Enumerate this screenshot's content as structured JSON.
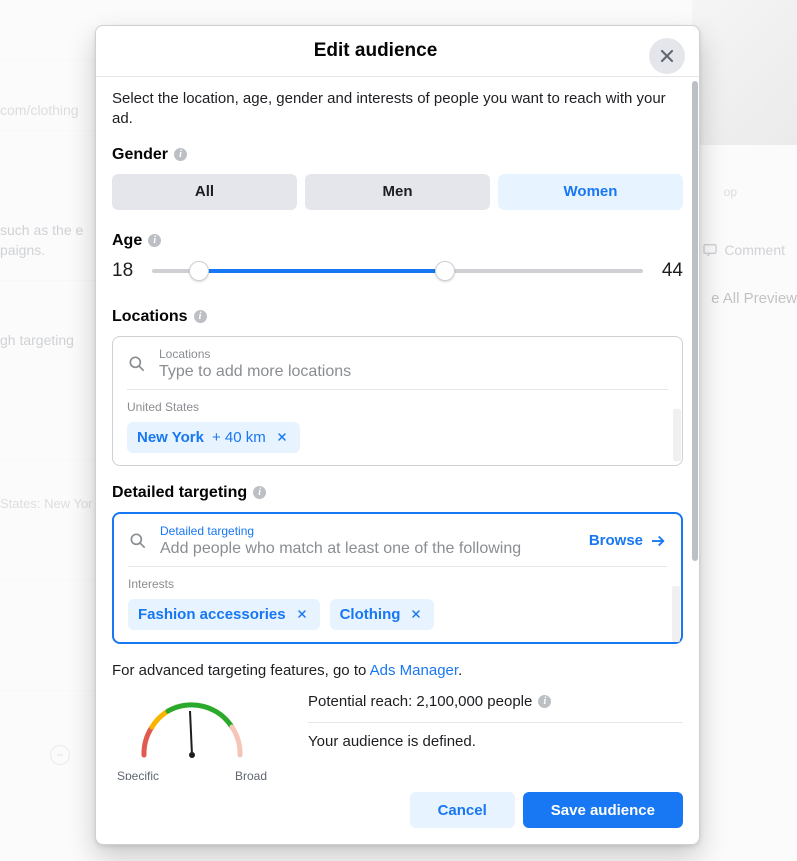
{
  "backdrop": {
    "url_fragment": "com/clothing",
    "line1": "such as the e",
    "line2": "paigns.",
    "targeting_label": "gh targeting",
    "states_line": "States: New Yor",
    "preview_link": "e All Preview",
    "shop": "op",
    "comment": "Comment"
  },
  "modal": {
    "title": "Edit audience",
    "intro": "Select the location, age, gender and interests of people you want to reach with your ad.",
    "gender": {
      "label": "Gender",
      "options": [
        "All",
        "Men",
        "Women"
      ],
      "selected": "Women"
    },
    "age": {
      "label": "Age",
      "min": 18,
      "max": 44,
      "range_min": 13,
      "range_max": 65
    },
    "locations": {
      "label": "Locations",
      "search_label": "Locations",
      "placeholder": "Type to add more locations",
      "group_label": "United States",
      "chips": [
        {
          "name": "New York",
          "radius": "+ 40 km"
        }
      ]
    },
    "targeting": {
      "label": "Detailed targeting",
      "search_label": "Detailed targeting",
      "placeholder": "Add people who match at least one of the following",
      "browse": "Browse",
      "group_label": "Interests",
      "chips": [
        "Fashion accessories",
        "Clothing"
      ]
    },
    "advanced_prefix": "For advanced targeting features, go to ",
    "advanced_link": "Ads Manager",
    "gauge": {
      "specific": "Specific",
      "broad": "Broad"
    },
    "reach_prefix": "Potential reach: ",
    "reach_value": "2,100,000 people",
    "defined": "Your audience is defined.",
    "cancel": "Cancel",
    "save": "Save audience"
  }
}
